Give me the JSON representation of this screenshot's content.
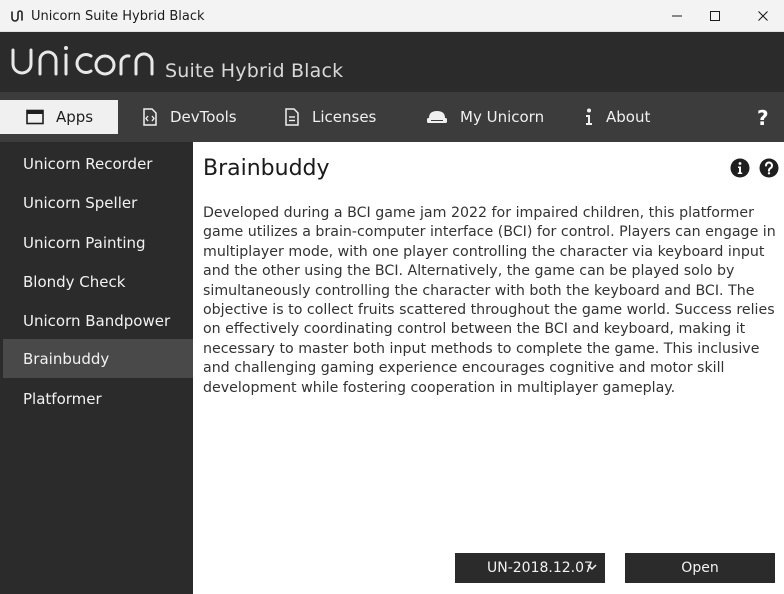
{
  "window": {
    "title": "Unicorn Suite Hybrid Black"
  },
  "header": {
    "logo_text": "unicorn",
    "subtitle": "Suite Hybrid Black"
  },
  "tabs": [
    {
      "label": "Apps",
      "icon": "window-icon",
      "active": true
    },
    {
      "label": "DevTools",
      "icon": "code-file-icon",
      "active": false
    },
    {
      "label": "Licenses",
      "icon": "document-icon",
      "active": false
    },
    {
      "label": "My Unicorn",
      "icon": "headset-device-icon",
      "active": false
    },
    {
      "label": "About",
      "icon": "info-icon",
      "active": false
    }
  ],
  "help_label": "?",
  "sidebar": {
    "items": [
      {
        "label": "Unicorn Recorder"
      },
      {
        "label": "Unicorn Speller"
      },
      {
        "label": "Unicorn Painting"
      },
      {
        "label": "Blondy Check"
      },
      {
        "label": "Unicorn Bandpower"
      },
      {
        "label": "Brainbuddy",
        "active": true
      },
      {
        "label": "Platformer"
      }
    ]
  },
  "content": {
    "title": "Brainbuddy",
    "description": "Developed during a BCI game jam 2022 for impaired children, this platformer game utilizes a brain-computer interface (BCI) for control. Players can engage in multiplayer mode, with one player controlling the character via keyboard input and the other using the BCI. Alternatively, the game can be played solo by simultaneously controlling the character with both the keyboard and BCI. The objective is to collect fruits scattered throughout the game world. Success relies on effectively coordinating control between the BCI and keyboard, making it necessary to master both input methods to complete the game. This inclusive and challenging gaming experience encourages cognitive and motor skill development while fostering cooperation in multiplayer gameplay.",
    "version_selected": "UN-2018.12.07",
    "open_label": "Open"
  },
  "colors": {
    "dark_bg": "#2b2b2b",
    "tabbar_bg": "#3c3c3c",
    "active_side": "#494949",
    "content_bg": "#ffffff"
  }
}
